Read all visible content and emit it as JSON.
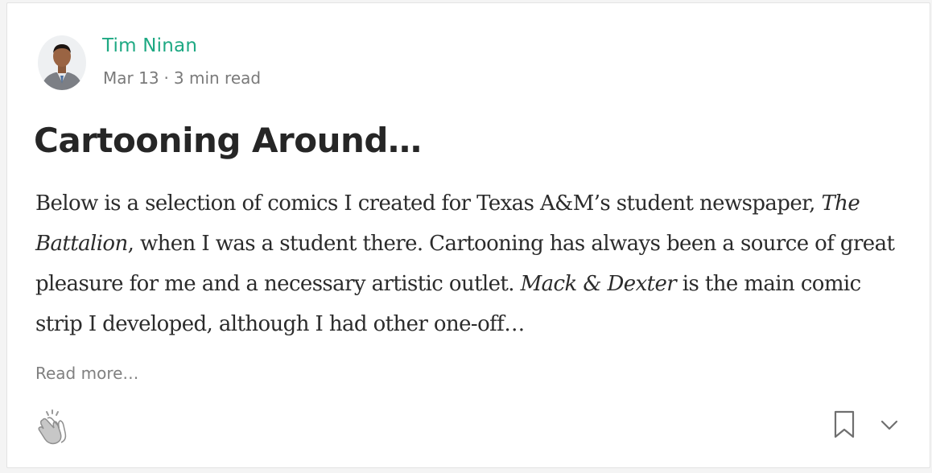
{
  "post": {
    "author": {
      "name": "Tim Ninan",
      "avatar_icon": "author-avatar"
    },
    "date": "Mar 13",
    "separator": "·",
    "read_time": "3 min read",
    "title": "Cartooning Around…",
    "excerpt": {
      "part1": "Below is a selection of comics I created for Texas A&M’s student newspaper, ",
      "italic1": "The Battalion",
      "part2": ", when I was a student there. Cartooning has always been a source of great pleasure for me and a necessary artistic outlet. ",
      "italic2": "Mack & Dexter",
      "part3": " is the main comic strip I developed, although I had other one-off…"
    },
    "read_more": "Read more…",
    "actions": {
      "clap_icon": "clap-icon",
      "bookmark_icon": "bookmark-icon",
      "more_icon": "chevron-down-icon"
    }
  },
  "colors": {
    "author": "#1ea983",
    "meta": "#7a7a7a",
    "title": "#262626",
    "body": "#2b2b2b",
    "icons": "#8a8a8a"
  }
}
